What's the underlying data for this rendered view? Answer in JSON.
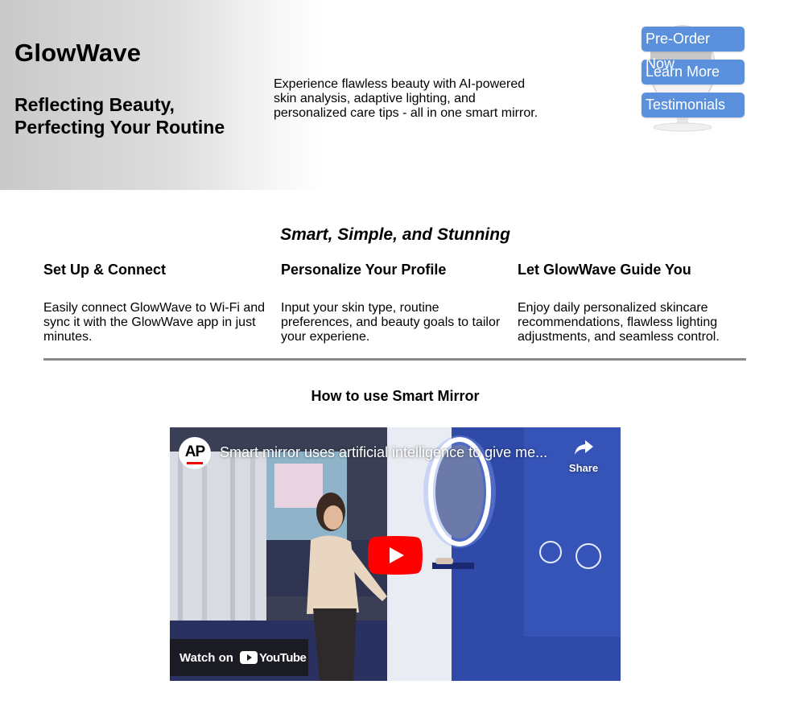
{
  "hero": {
    "brand": "GlowWave",
    "tagline_line1": "Reflecting Beauty,",
    "tagline_line2": "Perfecting Your Routine",
    "description": "Experience flawless beauty with AI-powered skin analysis, adaptive lighting, and personalized care tips - all in one smart mirror.",
    "buttons": [
      "Pre-Order Now",
      "Learn More",
      "Testimonials"
    ]
  },
  "steps_section": {
    "title": "Smart, Simple, and Stunning",
    "steps": [
      {
        "title": "Set Up & Connect",
        "text": "Easily connect GlowWave to Wi-Fi and sync it with the GlowWave app in just minutes."
      },
      {
        "title": "Personalize Your Profile",
        "text": "Input your skin type, routine preferences, and beauty goals to tailor your experiene."
      },
      {
        "title": "Let GlowWave Guide You",
        "text": "Enjoy daily personalized skincare recommendations, flawless lighting adjustments, and seamless control."
      }
    ]
  },
  "video_section": {
    "title": "How to use Smart Mirror",
    "channel_logo": "AP",
    "video_title": "Smart mirror uses artificial intelligence to give me...",
    "share_label": "Share",
    "watch_on_label": "Watch on",
    "platform": "YouTube"
  },
  "colors": {
    "button_blue": "#5b90dc",
    "youtube_red": "#ff0000",
    "divider_gray": "#8a8a8a"
  }
}
